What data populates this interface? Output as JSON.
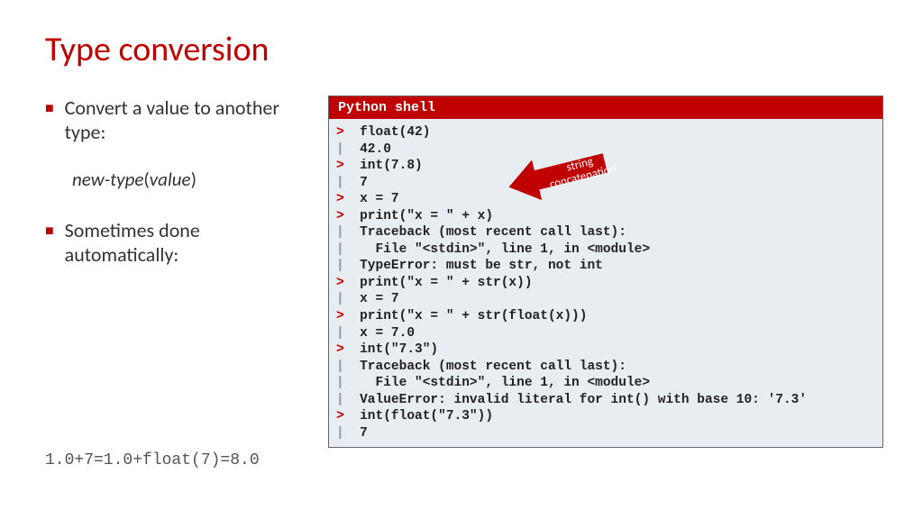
{
  "title": "Type conversion",
  "left": {
    "bullet1": "Convert a value to another type:",
    "syntax_left": "new-type",
    "syntax_paren_open": "(",
    "syntax_arg": "value",
    "syntax_paren_close": ")",
    "bullet2": "Sometimes done automatically:",
    "note": "1.0+7=1.0+float(7)=8.0"
  },
  "shell": {
    "header": "Python shell",
    "lines": [
      {
        "p": ">",
        "t": "float(42)"
      },
      {
        "p": "|",
        "t": "42.0"
      },
      {
        "p": ">",
        "t": "int(7.8)"
      },
      {
        "p": "|",
        "t": "7"
      },
      {
        "p": ">",
        "t": "x = 7"
      },
      {
        "p": ">",
        "t": "print(\"x = \" + x)"
      },
      {
        "p": "|",
        "t": "Traceback (most recent call last):"
      },
      {
        "p": "|",
        "t": "  File \"<stdin>\", line 1, in <module>"
      },
      {
        "p": "|",
        "t": "TypeError: must be str, not int"
      },
      {
        "p": ">",
        "t": "print(\"x = \" + str(x))"
      },
      {
        "p": "|",
        "t": "x = 7"
      },
      {
        "p": ">",
        "t": "print(\"x = \" + str(float(x)))"
      },
      {
        "p": "|",
        "t": "x = 7.0"
      },
      {
        "p": ">",
        "t": "int(\"7.3\")"
      },
      {
        "p": "|",
        "t": "Traceback (most recent call last):"
      },
      {
        "p": "|",
        "t": "  File \"<stdin>\", line 1, in <module>"
      },
      {
        "p": "|",
        "t": "ValueError: invalid literal for int() with base 10: '7.3'"
      },
      {
        "p": ">",
        "t": "int(float(\"7.3\"))"
      },
      {
        "p": "|",
        "t": "7"
      }
    ]
  },
  "arrow_label": "string concatenation"
}
